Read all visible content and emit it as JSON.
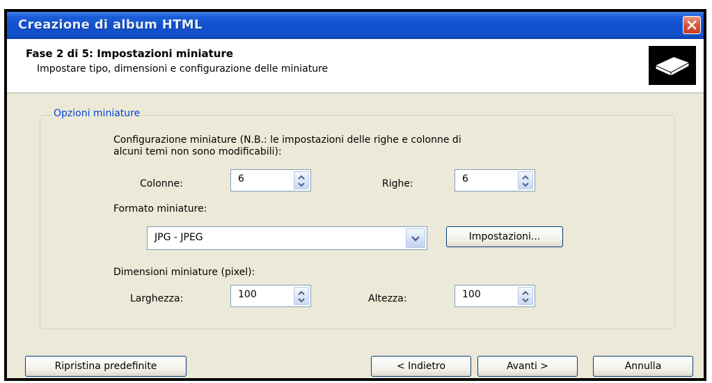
{
  "window": {
    "title": "Creazione di album HTML"
  },
  "header": {
    "phase_title": "Fase 2 di 5: Impostazioni miniature",
    "phase_subtitle": "Impostare tipo, dimensioni e configurazione delle miniature",
    "icon": "album-icon"
  },
  "options": {
    "group_label": "Opzioni miniature",
    "layout_note_line1": "Configurazione miniature (N.B.: le impostazioni delle righe e colonne di",
    "layout_note_line2": "alcuni temi non sono modificabili):",
    "columns_label": "Colonne:",
    "columns_value": "6",
    "rows_label": "Righe:",
    "rows_value": "6",
    "format_label": "Formato miniature:",
    "format_value": "JPG - JPEG",
    "settings_button": "Impostazioni...",
    "size_label": "Dimensioni miniature (pixel):",
    "width_label": "Larghezza:",
    "width_value": "100",
    "height_label": "Altezza:",
    "height_value": "100"
  },
  "footer": {
    "reset_button": "Ripristina predefinite",
    "back_button": "< Indietro",
    "next_button": "Avanti >",
    "cancel_button": "Annulla"
  },
  "colors": {
    "titlebar": "#0f4fcf",
    "group_label": "#0046d5",
    "dialog_bg": "#ece9d8",
    "close_button": "#d7573a"
  }
}
